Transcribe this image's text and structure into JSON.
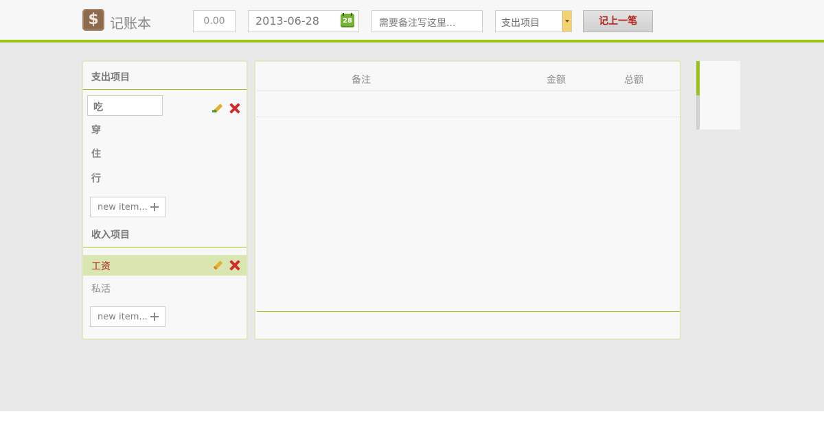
{
  "header": {
    "app_title": "记账本",
    "logo_symbol": "$",
    "amount_value": "0.00",
    "date_value": "2013-06-28",
    "calendar_day": "28",
    "note_placeholder": "需要备注写这里...",
    "category_selected": "支出项目",
    "record_button_label": "记上一笔"
  },
  "expense": {
    "title": "支出项目",
    "editing_value": "吃",
    "items": [
      "穿",
      "住",
      "行"
    ],
    "new_item_label": "new item..."
  },
  "income": {
    "title": "收入项目",
    "items": [
      "工资",
      "私活"
    ],
    "selected_index": 0,
    "new_item_label": "new item..."
  },
  "table": {
    "columns": [
      "备注",
      "金额",
      "总额"
    ]
  },
  "colors": {
    "accent": "#9cc31b",
    "danger": "#d22b2b",
    "selected_row": "#d9e6b2"
  }
}
